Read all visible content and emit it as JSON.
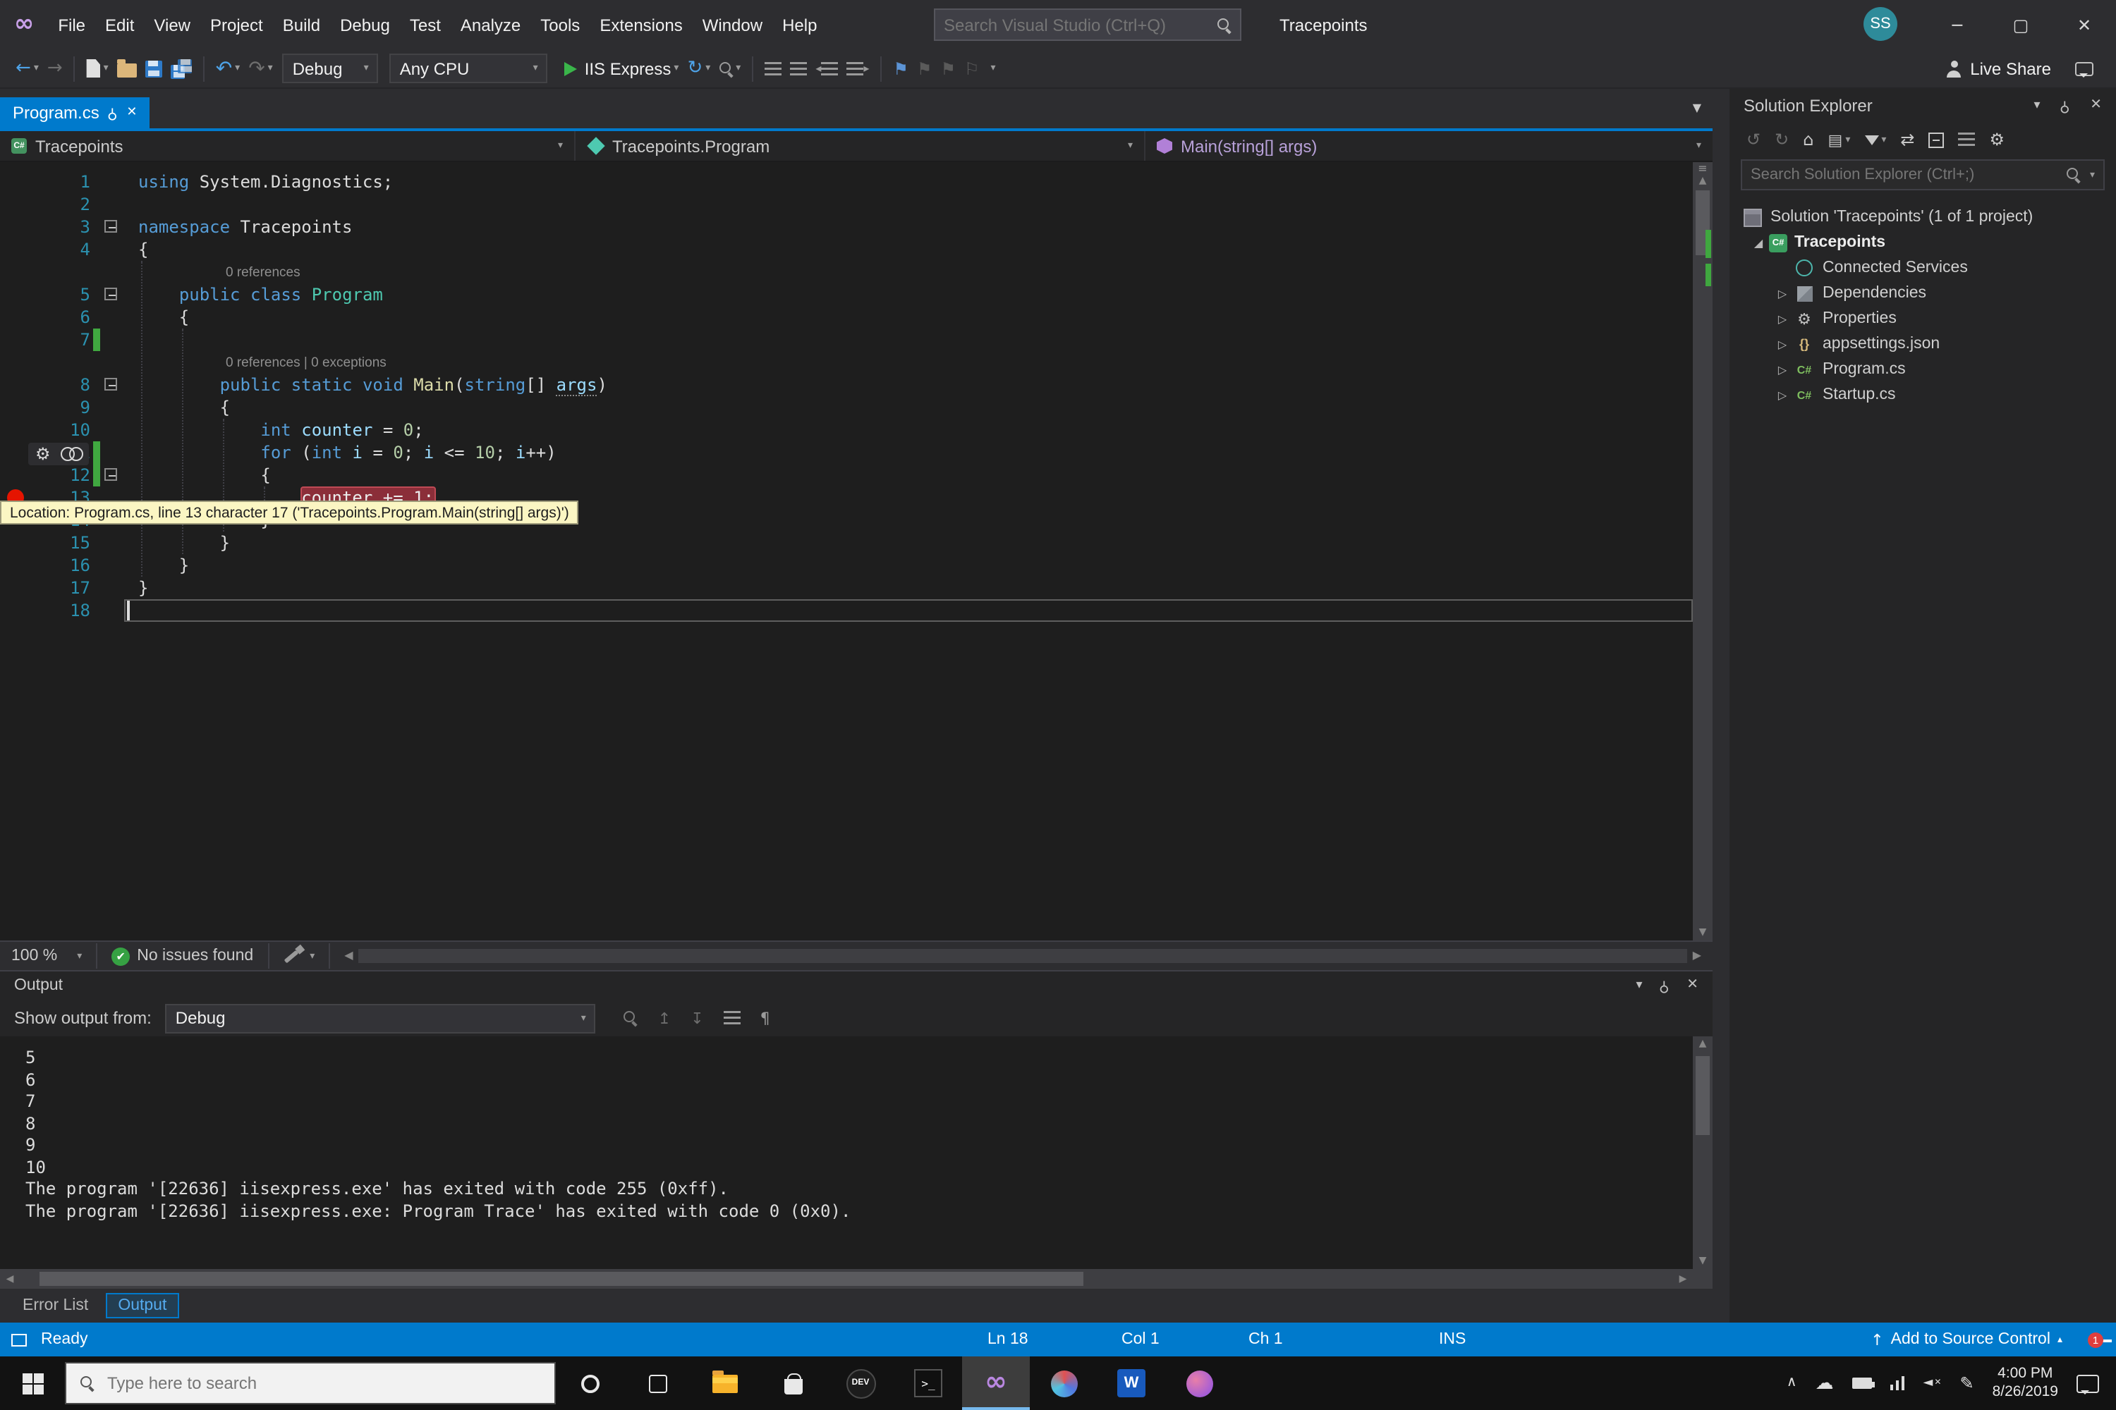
{
  "colors": {
    "accent": "#007acc",
    "breakpoint": "#e51400",
    "editor_bg": "#1e1e1e",
    "statusbar": "#007acc"
  },
  "titlebar": {
    "menus": [
      "File",
      "Edit",
      "View",
      "Project",
      "Build",
      "Debug",
      "Test",
      "Analyze",
      "Tools",
      "Extensions",
      "Window",
      "Help"
    ],
    "search_placeholder": "Search Visual Studio (Ctrl+Q)",
    "window_title": "Tracepoints",
    "avatar_initials": "SS"
  },
  "toolbar": {
    "configuration": "Debug",
    "platform": "Any CPU",
    "run_target": "IIS Express",
    "live_share": "Live Share"
  },
  "editor": {
    "tab_label": "Program.cs",
    "breadcrumbs": {
      "project": "Tracepoints",
      "type": "Tracepoints.Program",
      "member": "Main(string[] args)"
    },
    "tooltip": "Location: Program.cs, line 13 character 17 ('Tracepoints.Program.Main(string[] args)')",
    "zoom": "100 %",
    "health": "No issues found",
    "lines": [
      {
        "num": "1",
        "tokens": [
          [
            "k",
            "using"
          ],
          [
            "p",
            " System.Diagnostics;"
          ]
        ]
      },
      {
        "num": "2",
        "tokens": []
      },
      {
        "num": "3",
        "fold": true,
        "tokens": [
          [
            "k",
            "namespace"
          ],
          [
            "p",
            " Tracepoints"
          ]
        ]
      },
      {
        "num": "4",
        "tokens": [
          [
            "p",
            "{"
          ]
        ]
      },
      {
        "codelens": true,
        "tokens": [
          [
            "cl",
            "0 references"
          ]
        ]
      },
      {
        "num": "5",
        "fold": true,
        "tokens": [
          [
            "p",
            "    "
          ],
          [
            "k",
            "public"
          ],
          [
            "p",
            " "
          ],
          [
            "k",
            "class"
          ],
          [
            "p",
            " "
          ],
          [
            "t",
            "Program"
          ]
        ]
      },
      {
        "num": "6",
        "tokens": [
          [
            "p",
            "    {"
          ]
        ]
      },
      {
        "num": "7",
        "changed": true,
        "tokens": []
      },
      {
        "codelens": true,
        "tokens": [
          [
            "cl",
            "0 references | 0 exceptions"
          ]
        ]
      },
      {
        "num": "8",
        "fold": true,
        "tokens": [
          [
            "p",
            "        "
          ],
          [
            "k",
            "public"
          ],
          [
            "p",
            " "
          ],
          [
            "k",
            "static"
          ],
          [
            "p",
            " "
          ],
          [
            "k",
            "void"
          ],
          [
            "p",
            " "
          ],
          [
            "m",
            "Main"
          ],
          [
            "p",
            "("
          ],
          [
            "k",
            "string"
          ],
          [
            "p",
            "[] "
          ],
          [
            "lu",
            "args"
          ],
          [
            "p",
            ")"
          ]
        ]
      },
      {
        "num": "9",
        "tokens": [
          [
            "p",
            "        {"
          ]
        ]
      },
      {
        "num": "10",
        "tokens": [
          [
            "p",
            "            "
          ],
          [
            "k",
            "int"
          ],
          [
            "p",
            " "
          ],
          [
            "l",
            "counter"
          ],
          [
            "p",
            " = "
          ],
          [
            "n",
            "0"
          ],
          [
            "p",
            ";"
          ]
        ]
      },
      {
        "num": "11",
        "changed": true,
        "tokens": [
          [
            "p",
            "            "
          ],
          [
            "k",
            "for"
          ],
          [
            "p",
            " ("
          ],
          [
            "k",
            "int"
          ],
          [
            "p",
            " "
          ],
          [
            "l",
            "i"
          ],
          [
            "p",
            " = "
          ],
          [
            "n",
            "0"
          ],
          [
            "p",
            "; "
          ],
          [
            "l",
            "i"
          ],
          [
            "p",
            " <= "
          ],
          [
            "n",
            "10"
          ],
          [
            "p",
            "; "
          ],
          [
            "l",
            "i"
          ],
          [
            "p",
            "++)"
          ]
        ]
      },
      {
        "num": "12",
        "fold": true,
        "changed": true,
        "tokens": [
          [
            "p",
            "            {"
          ]
        ]
      },
      {
        "num": "13",
        "bp": true,
        "tokens": [
          [
            "p",
            "                "
          ],
          [
            "bp",
            "counter += 1;"
          ]
        ]
      },
      {
        "num": "14",
        "tokens": [
          [
            "p",
            "            }"
          ]
        ]
      },
      {
        "num": "15",
        "tokens": [
          [
            "p",
            "        }"
          ]
        ]
      },
      {
        "num": "16",
        "tokens": [
          [
            "p",
            "    }"
          ]
        ]
      },
      {
        "num": "17",
        "tokens": [
          [
            "p",
            "}"
          ]
        ]
      },
      {
        "num": "18",
        "caret": true,
        "tokens": []
      }
    ]
  },
  "output": {
    "title": "Output",
    "show_output_from_label": "Show output from:",
    "source": "Debug",
    "lines": [
      "5",
      "6",
      "7",
      "8",
      "9",
      "10",
      "The program '[22636] iisexpress.exe' has exited with code 255 (0xff).",
      "The program '[22636] iisexpress.exe: Program Trace' has exited with code 0 (0x0)."
    ],
    "tabs": {
      "error_list": "Error List",
      "output": "Output"
    }
  },
  "solution_explorer": {
    "title": "Solution Explorer",
    "search_placeholder": "Search Solution Explorer (Ctrl+;)",
    "items": [
      {
        "label": "Solution 'Tracepoints' (1 of 1 project)",
        "icon": "solution",
        "indent": 8
      },
      {
        "label": "Tracepoints",
        "icon": "project",
        "indent": 13,
        "arrow": "exp",
        "bold": true
      },
      {
        "label": "Connected Services",
        "icon": "services",
        "indent": 30,
        "arrow": "spacer"
      },
      {
        "label": "Dependencies",
        "icon": "dependencies",
        "indent": 30,
        "arrow": "col"
      },
      {
        "label": "Properties",
        "icon": "properties",
        "indent": 30,
        "arrow": "col"
      },
      {
        "label": "appsettings.json",
        "icon": "json",
        "indent": 30,
        "arrow": "col"
      },
      {
        "label": "Program.cs",
        "icon": "cs",
        "indent": 30,
        "arrow": "col"
      },
      {
        "label": "Startup.cs",
        "icon": "cs",
        "indent": 30,
        "arrow": "col"
      }
    ]
  },
  "statusbar": {
    "state": "Ready",
    "line": "Ln 18",
    "column": "Col 1",
    "character": "Ch 1",
    "mode": "INS",
    "source_control": "Add to Source Control",
    "notification_count": "1"
  },
  "taskbar": {
    "search_placeholder": "Type here to search",
    "dev_badge": "DEV",
    "terminal_glyph": "&gt;_",
    "terminal_text": ">_",
    "word_initial": "W",
    "vs_glyph": "∞",
    "time": "4:00 PM",
    "date": "8/26/2019"
  }
}
